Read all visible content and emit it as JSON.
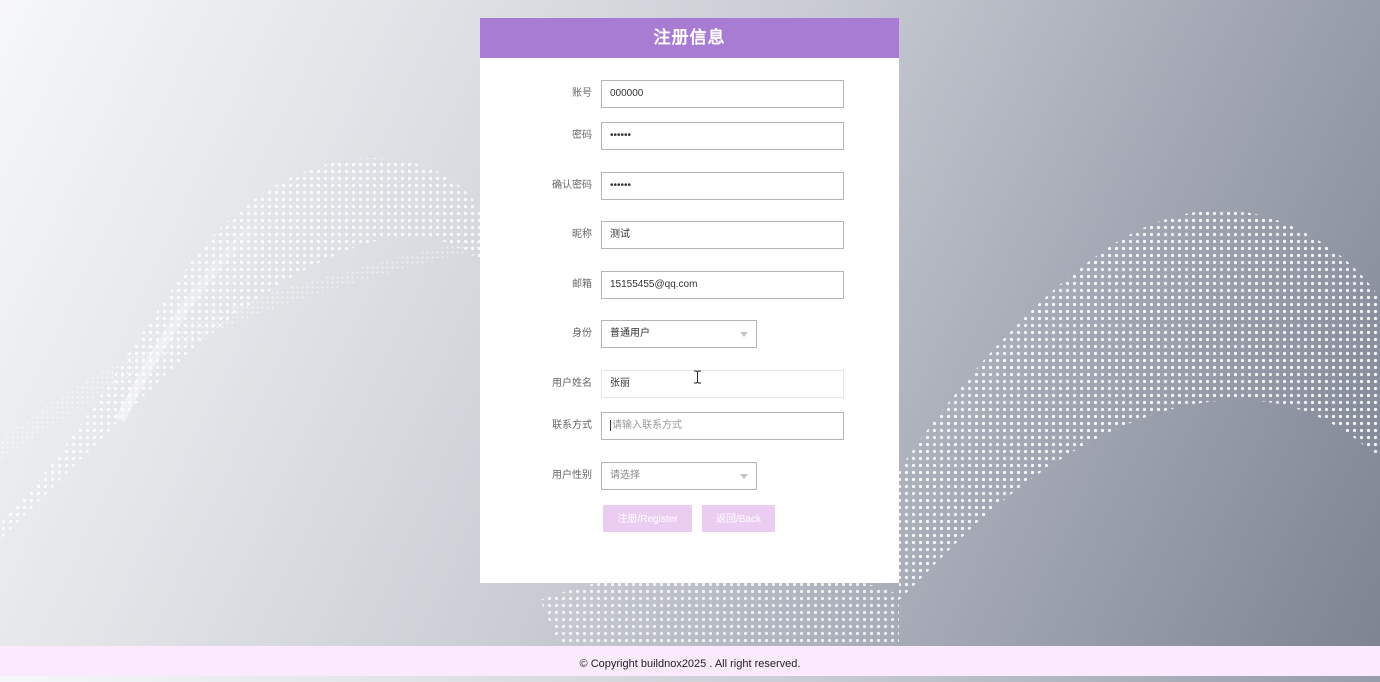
{
  "header": {
    "title": "注册信息"
  },
  "form": {
    "account": {
      "label": "账号",
      "value": "000000"
    },
    "password": {
      "label": "密码",
      "value": "••••••"
    },
    "confirm_password": {
      "label": "确认密码",
      "value": "••••••"
    },
    "nickname": {
      "label": "昵称",
      "value": "测试"
    },
    "email": {
      "label": "邮箱",
      "value": "15155455@qq.com"
    },
    "identity": {
      "label": "身份",
      "value": "普通用户"
    },
    "user_name": {
      "label": "用户姓名",
      "value": "张丽"
    },
    "contact": {
      "label": "联系方式",
      "placeholder": "请输入联系方式"
    },
    "gender": {
      "label": "用户性别",
      "value": "请选择"
    }
  },
  "buttons": {
    "register": "注册/Register",
    "back": "返回/Back"
  },
  "footer": {
    "copyright": "© Copyright buildnox2025 . All right reserved."
  },
  "colors": {
    "header": "#a97cd3",
    "button": "#ebcdf2",
    "footer": "#fbe9fd"
  }
}
